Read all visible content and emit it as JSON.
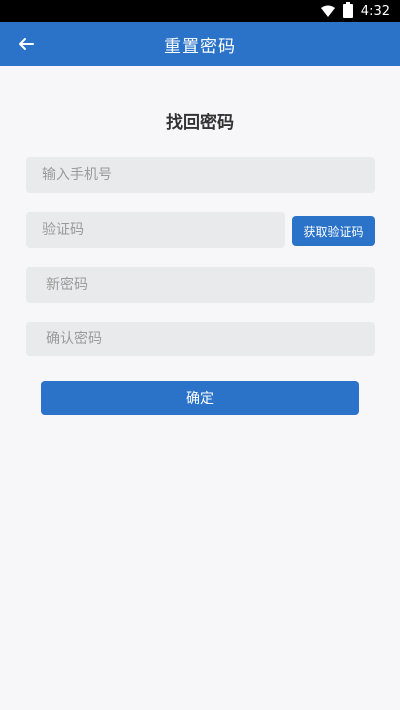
{
  "status_bar": {
    "time": "4:32"
  },
  "app_bar": {
    "title": "重置密码",
    "back_icon": "arrow-left-icon"
  },
  "form": {
    "heading": "找回密码",
    "phone": {
      "placeholder": "输入手机号",
      "value": ""
    },
    "code": {
      "placeholder": "验证码",
      "value": ""
    },
    "get_code_label": "获取验证码",
    "new_password": {
      "placeholder": "新密码",
      "value": ""
    },
    "confirm_password": {
      "placeholder": "确认密码",
      "value": ""
    },
    "submit_label": "确定"
  },
  "colors": {
    "primary": "#2a73c9",
    "field_bg": "#e9eaeb",
    "page_bg": "#f7f7f9"
  }
}
